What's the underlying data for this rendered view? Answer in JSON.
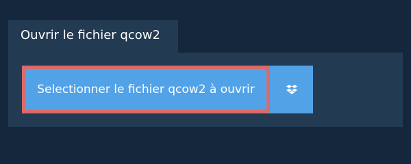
{
  "tab": {
    "title": "Ouvrir le fichier qcow2"
  },
  "actions": {
    "select_file_label": "Selectionner le fichier qcow2 à ouvrir",
    "dropbox_icon": "dropbox-icon"
  },
  "colors": {
    "background": "#14273d",
    "panel": "#223a52",
    "button": "#52a2e8",
    "focus_border": "#d96b6b",
    "text": "#ffffff"
  }
}
